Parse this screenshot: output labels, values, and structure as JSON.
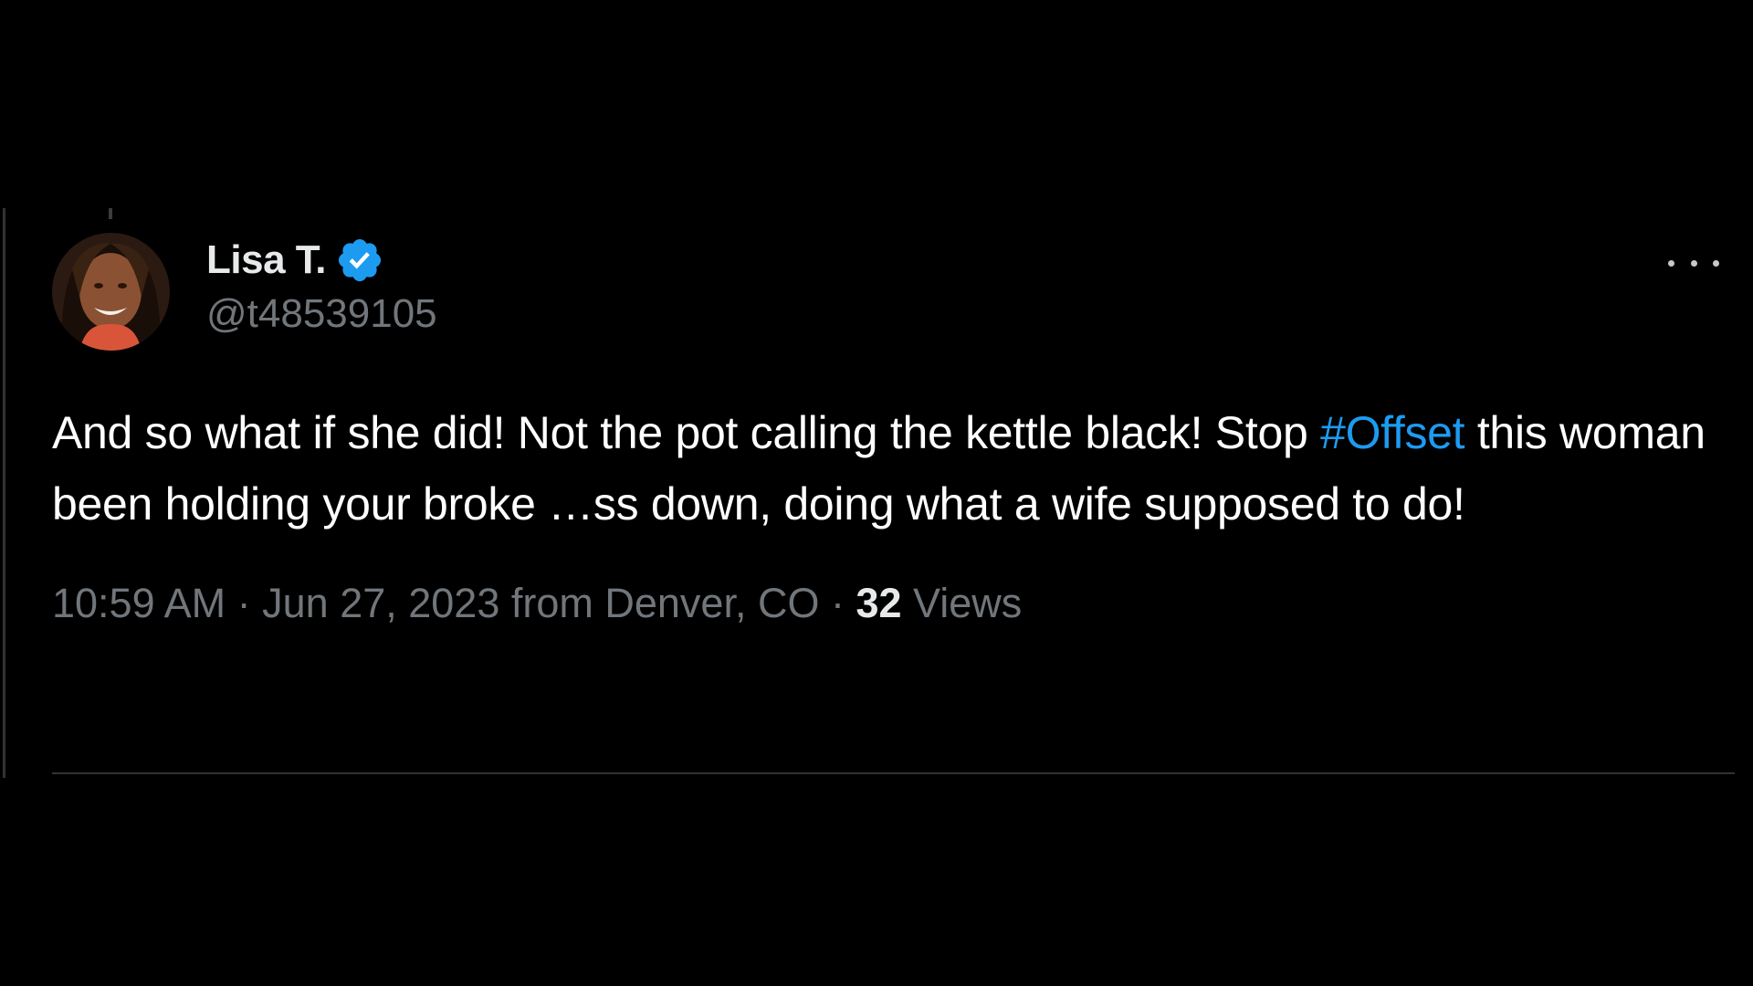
{
  "author": {
    "display_name": "Lisa T.",
    "handle": "@t48539105",
    "verified": true,
    "avatar_icon": "profile-photo"
  },
  "tweet": {
    "text_before": "And so what if she did! Not the pot calling the kettle black! Stop ",
    "hashtag": "#Offset",
    "text_after": " this woman been holding your broke ",
    "censored_word": "…ss",
    "text_end": " down, doing what a wife supposed to do!"
  },
  "meta": {
    "time": "10:59 AM",
    "separator_1": " · ",
    "date": "Jun 27, 2023",
    "location": " from Denver, CO",
    "separator_2": " · ",
    "views_count": "32",
    "views_label": " Views"
  },
  "icons": {
    "verified": "verified-badge-icon",
    "more": "more-icon"
  },
  "colors": {
    "background": "#000000",
    "text": "#e7e9ea",
    "secondary": "#71767b",
    "accent": "#1d9bf0",
    "divider": "#2f3336"
  }
}
